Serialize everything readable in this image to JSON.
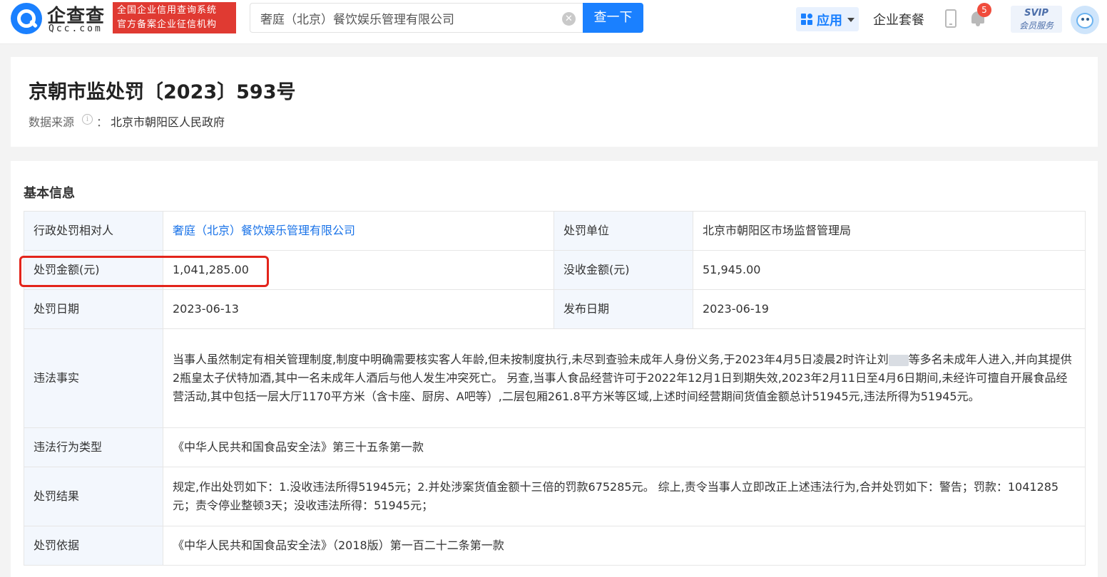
{
  "header": {
    "logo_text": "企查查",
    "logo_domain": "Qcc.com",
    "slogan_line1": "全国企业信用查询系统",
    "slogan_line2": "官方备案企业征信机构",
    "search_value": "奢庭（北京）餐饮娱乐管理有限公司",
    "search_button": "查一下",
    "apps_label": "应用",
    "suite_label": "企业套餐",
    "notification_count": "5",
    "svip_line1": "SVIP",
    "svip_line2": "会员服务"
  },
  "record": {
    "title": "京朝市监处罚〔2023〕593号",
    "source_label": "数据来源",
    "source_value": "北京市朝阳区人民政府"
  },
  "basic_info": {
    "section_title": "基本信息",
    "rows": [
      {
        "label": "行政处罚相对人",
        "value": "奢庭（北京）餐饮娱乐管理有限公司",
        "label2": "处罚单位",
        "value2": "北京市朝阳区市场监督管理局"
      },
      {
        "label": "处罚金额(元)",
        "value": "1,041,285.00",
        "label2": "没收金额(元)",
        "value2": "51,945.00"
      },
      {
        "label": "处罚日期",
        "value": "2023-06-13",
        "label2": "发布日期",
        "value2": "2023-06-19"
      }
    ],
    "facts_label": "违法事实",
    "facts_part1": "当事人虽然制定有相关管理制度,制度中明确需要核实客人年龄,但未按制度执行,未尽到查验未成年人身份义务,于2023年4月5日凌晨2时许让刘",
    "facts_part2": "等多名未成年人进入,并向其提供2瓶皇太子伏特加酒,其中一名未成年人酒后与他人发生冲突死亡。 另查,当事人食品经营许可于2022年12月1日到期失效,2023年2月11日至4月6日期间,未经许可擅自开展食品经营活动,其中包括一层大厅1170平方米（含卡座、厨房、A吧等）,二层包厢261.8平方米等区域,上述时间经营期间货值金额总计51945元,违法所得为51945元。",
    "violation_type_label": "违法行为类型",
    "violation_type_value": "《中华人民共和国食品安全法》第三十五条第一款",
    "result_label": "处罚结果",
    "result_value": "规定,作出处罚如下：1.没收违法所得51945元；2.并处涉案货值金额十三倍的罚款675285元。 综上,责令当事人立即改正上述违法行为,合并处罚如下：警告；罚款：1041285元；责令停业整顿3天；没收违法所得：51945元；",
    "basis_label": "处罚依据",
    "basis_value": "《中华人民共和国食品安全法》（2018版）第一百二十二条第一款"
  }
}
